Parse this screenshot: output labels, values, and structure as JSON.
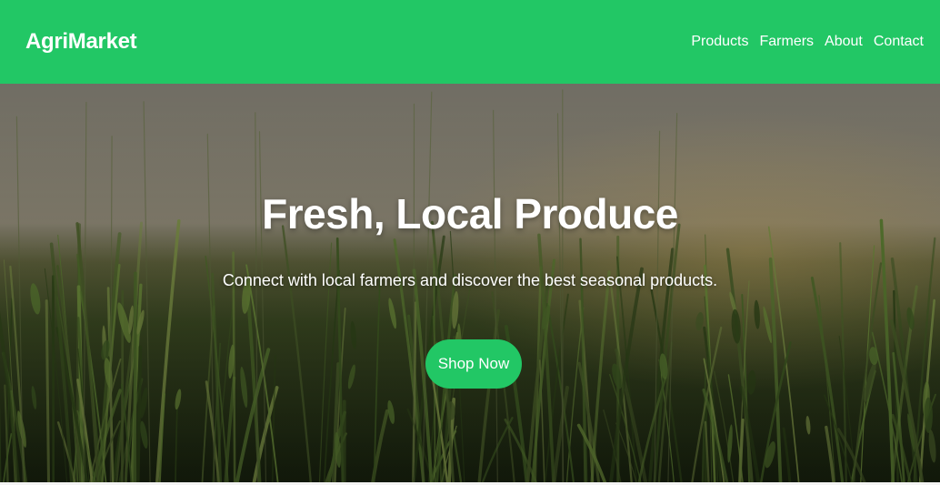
{
  "header": {
    "logo": "AgriMarket",
    "nav": [
      {
        "label": "Products"
      },
      {
        "label": "Farmers"
      },
      {
        "label": "About"
      },
      {
        "label": "Contact"
      }
    ]
  },
  "hero": {
    "title": "Fresh, Local Produce",
    "subtitle": "Connect with local farmers and discover the best seasonal products.",
    "cta_label": "Shop Now"
  },
  "colors": {
    "brand": "#22c765",
    "text_on_brand": "#ffffff"
  }
}
